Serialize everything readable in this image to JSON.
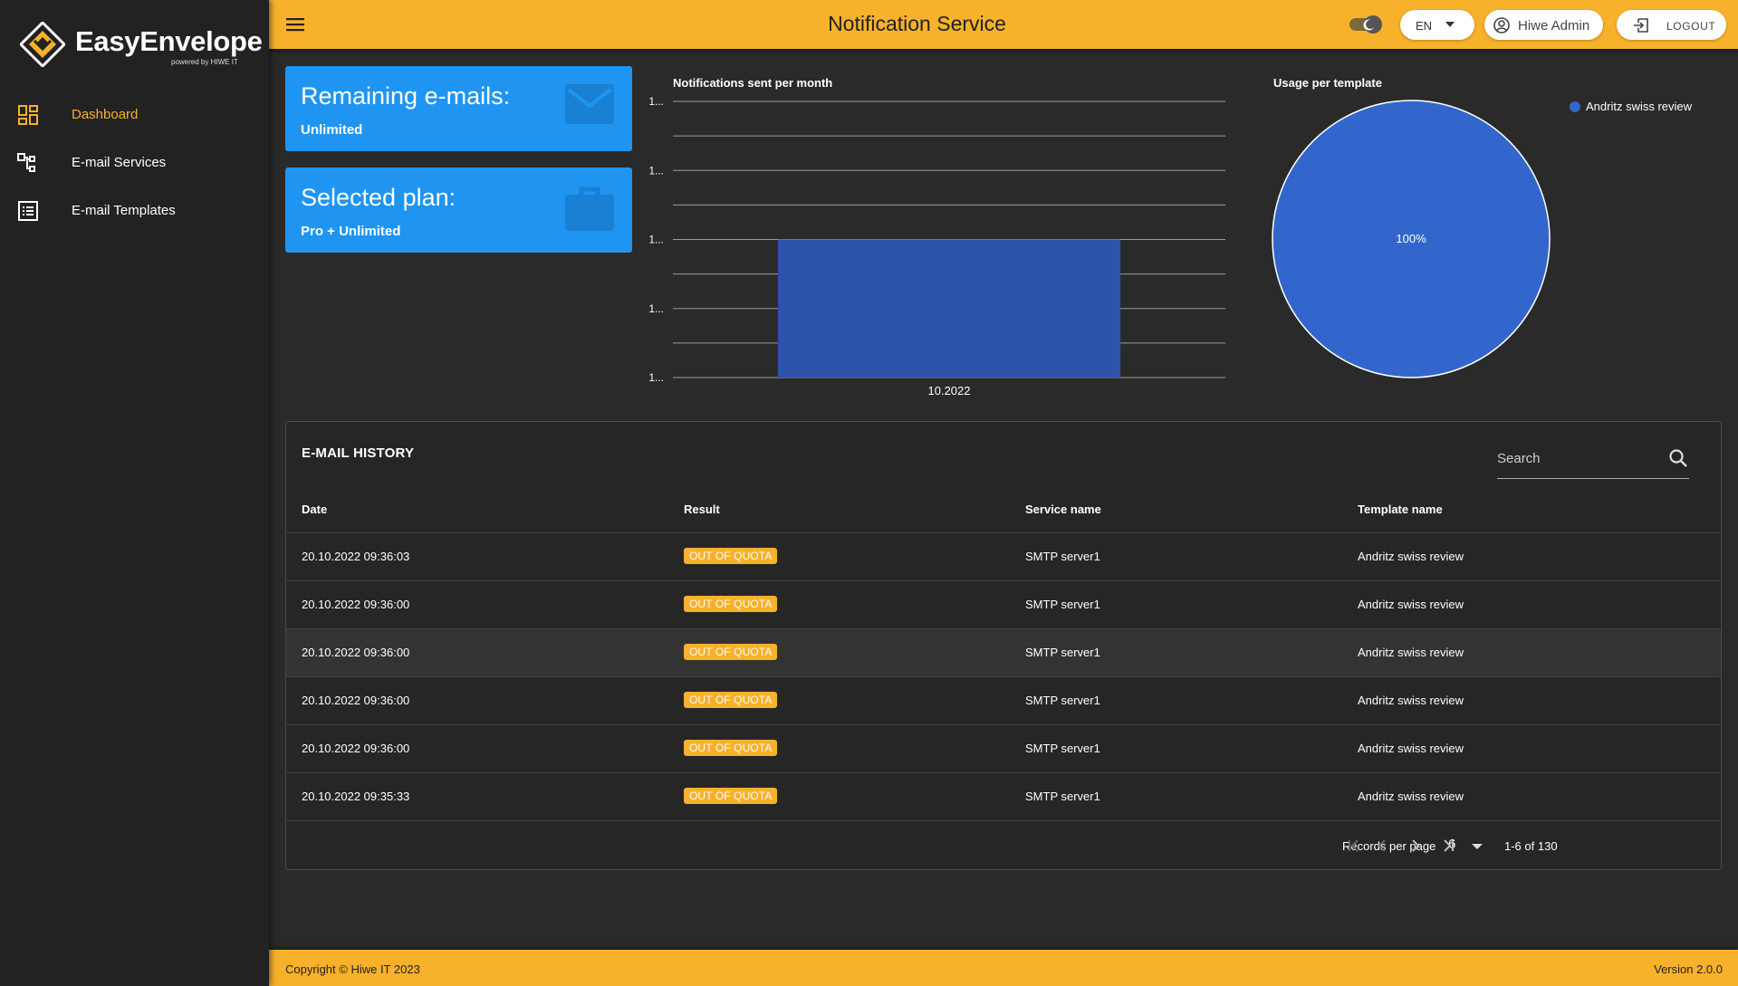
{
  "app": {
    "brand_name": "EasyEnvelope",
    "brand_tagline": "powered by HIWE IT"
  },
  "sidebar": {
    "items": [
      {
        "label": "Dashboard",
        "icon": "dashboard-icon",
        "active": true
      },
      {
        "label": "E-mail Services",
        "icon": "services-icon",
        "active": false
      },
      {
        "label": "E-mail Templates",
        "icon": "templates-icon",
        "active": false
      }
    ]
  },
  "header": {
    "title": "Notification Service",
    "language": "EN",
    "user_name": "Hiwe Admin",
    "logout_label": "LOGOUT"
  },
  "cards": {
    "remaining": {
      "title": "Remaining e-mails:",
      "value": "Unlimited",
      "icon": "envelope-icon"
    },
    "plan": {
      "title": "Selected plan:",
      "value": "Pro + Unlimited",
      "icon": "briefcase-icon"
    }
  },
  "chart_data": [
    {
      "type": "bar",
      "title": "Notifications sent per month",
      "categories": [
        "10.2022"
      ],
      "values": [
        130
      ],
      "ytick_labels": [
        "1...",
        "1...",
        "1...",
        "1...",
        "1..."
      ],
      "grid": true
    },
    {
      "type": "pie",
      "title": "Usage per template",
      "labels": [
        "Andritz swiss review"
      ],
      "values": [
        100
      ],
      "slice_labels": [
        "100%"
      ],
      "legend": "top-right"
    }
  ],
  "history": {
    "title": "E-MAIL HISTORY",
    "search_placeholder": "Search",
    "columns": [
      "Date",
      "Result",
      "Service name",
      "Template name"
    ],
    "rows": [
      {
        "date": "20.10.2022 09:36:03",
        "result": "OUT OF QUOTA",
        "service": "SMTP server1",
        "template": "Andritz swiss review"
      },
      {
        "date": "20.10.2022 09:36:00",
        "result": "OUT OF QUOTA",
        "service": "SMTP server1",
        "template": "Andritz swiss review"
      },
      {
        "date": "20.10.2022 09:36:00",
        "result": "OUT OF QUOTA",
        "service": "SMTP server1",
        "template": "Andritz swiss review"
      },
      {
        "date": "20.10.2022 09:36:00",
        "result": "OUT OF QUOTA",
        "service": "SMTP server1",
        "template": "Andritz swiss review"
      },
      {
        "date": "20.10.2022 09:36:00",
        "result": "OUT OF QUOTA",
        "service": "SMTP server1",
        "template": "Andritz swiss review"
      },
      {
        "date": "20.10.2022 09:35:33",
        "result": "OUT OF QUOTA",
        "service": "SMTP server1",
        "template": "Andritz swiss review"
      }
    ],
    "records_per_page_label": "Records per page",
    "records_per_page": "6",
    "range": "1-6 of 130"
  },
  "footer": {
    "copyright": "Copyright © Hiwe IT 2023",
    "version": "Version 2.0.0"
  },
  "colors": {
    "accent": "#f7b12b",
    "card_blue": "#1f95f1",
    "bar_blue": "#2e54a9",
    "pie_blue": "#3366cc",
    "background": "#2a2a2a",
    "sidebar": "#222222"
  }
}
